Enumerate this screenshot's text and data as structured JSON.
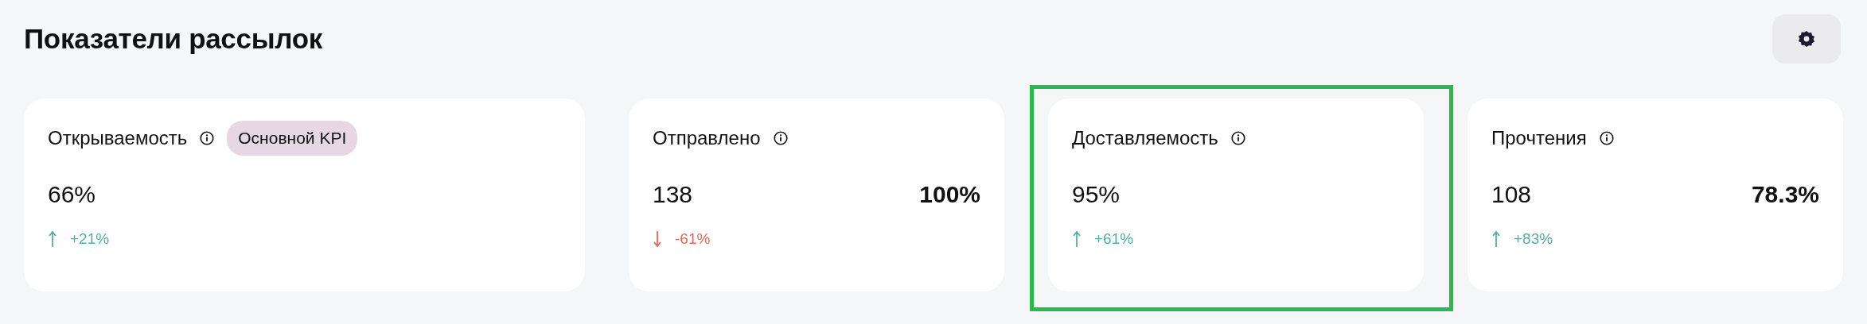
{
  "title": "Показатели рассылок",
  "cards": [
    {
      "label": "Открываемость",
      "badge": "Основной KPI",
      "value": "66%",
      "change": "+21%",
      "kind": "up",
      "highlighted": false
    },
    {
      "label": "Отправлено",
      "value": "138",
      "share": "100%",
      "change": "-61%",
      "kind": "down",
      "highlighted": false
    },
    {
      "label": "Доставляемость",
      "value": "95%",
      "change": "+61%",
      "kind": "up",
      "highlighted": true
    },
    {
      "label": "Прочтения",
      "value": "108",
      "share": "78.3%",
      "change": "+83%",
      "kind": "up",
      "highlighted": false
    }
  ]
}
